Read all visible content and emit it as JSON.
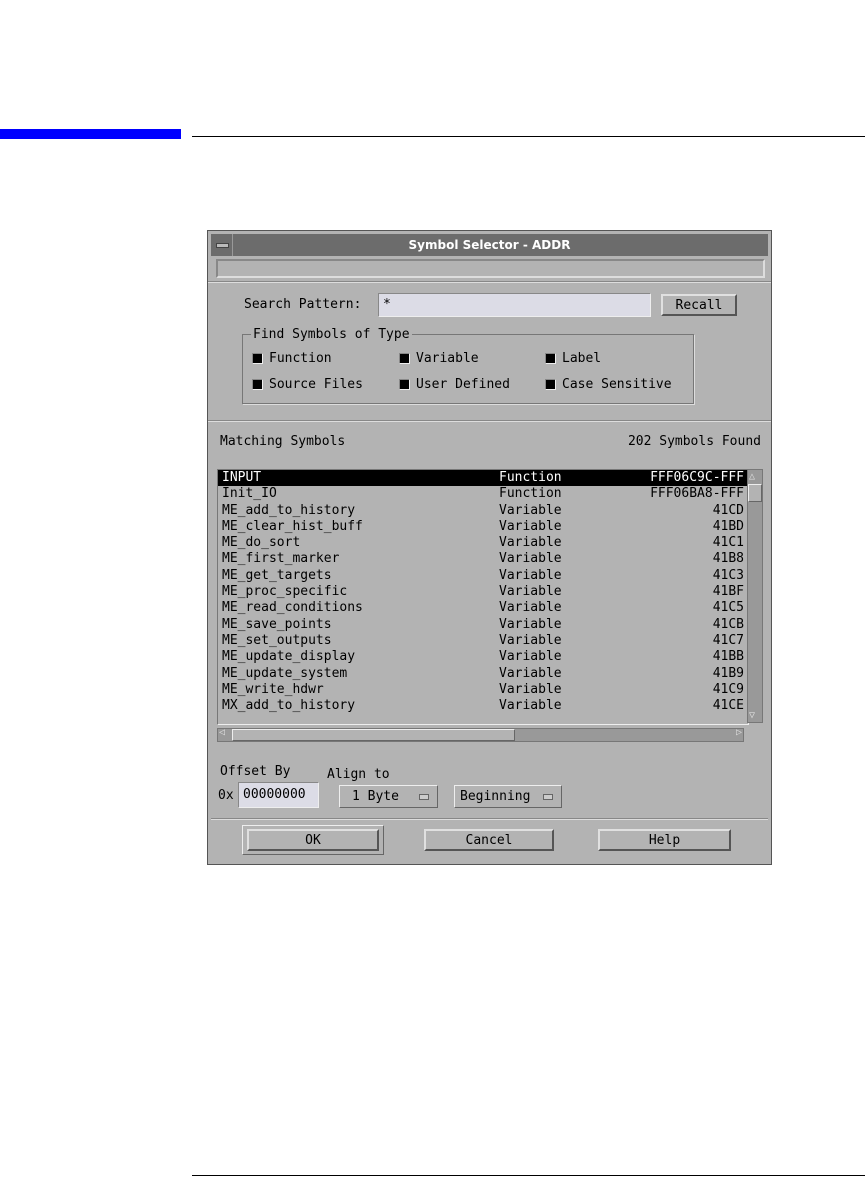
{
  "dialog": {
    "title": "Symbol Selector - ADDR",
    "search_label": "Search Pattern:",
    "search_value": "*",
    "recall_label": "Recall",
    "group_label": "Find Symbols of Type",
    "checkboxes": [
      {
        "label": "Function",
        "checked": true
      },
      {
        "label": "Variable",
        "checked": true
      },
      {
        "label": "Label",
        "checked": true
      },
      {
        "label": "Source Files",
        "checked": true
      },
      {
        "label": "User Defined",
        "checked": true
      },
      {
        "label": "Case Sensitive",
        "checked": true
      }
    ],
    "matching_label": "Matching Symbols",
    "found_label": "202 Symbols Found",
    "rows": [
      [
        "INPUT",
        "Function",
        "FFF06C9C-FFF"
      ],
      [
        "Init_IO",
        "Function",
        "FFF06BA8-FFF"
      ],
      [
        "ME_add_to_history",
        "Variable",
        "41CD"
      ],
      [
        "ME_clear_hist_buff",
        "Variable",
        "41BD"
      ],
      [
        "ME_do_sort",
        "Variable",
        "41C1"
      ],
      [
        "ME_first_marker",
        "Variable",
        "41B8"
      ],
      [
        "ME_get_targets",
        "Variable",
        "41C3"
      ],
      [
        "ME_proc_specific",
        "Variable",
        "41BF"
      ],
      [
        "ME_read_conditions",
        "Variable",
        "41C5"
      ],
      [
        "ME_save_points",
        "Variable",
        "41CB"
      ],
      [
        "ME_set_outputs",
        "Variable",
        "41C7"
      ],
      [
        "ME_update_display",
        "Variable",
        "41BB"
      ],
      [
        "ME_update_system",
        "Variable",
        "41B9"
      ],
      [
        "ME_write_hdwr",
        "Variable",
        "41C9"
      ],
      [
        "MX_add_to_history",
        "Variable",
        "41CE"
      ]
    ],
    "offset_label": "Offset By",
    "offset_prefix": "0x",
    "offset_value": "00000000",
    "align_label": "Align to",
    "align_value": "1 Byte",
    "align_pos_value": "Beginning",
    "ok_label": "OK",
    "cancel_label": "Cancel",
    "help_label": "Help"
  }
}
